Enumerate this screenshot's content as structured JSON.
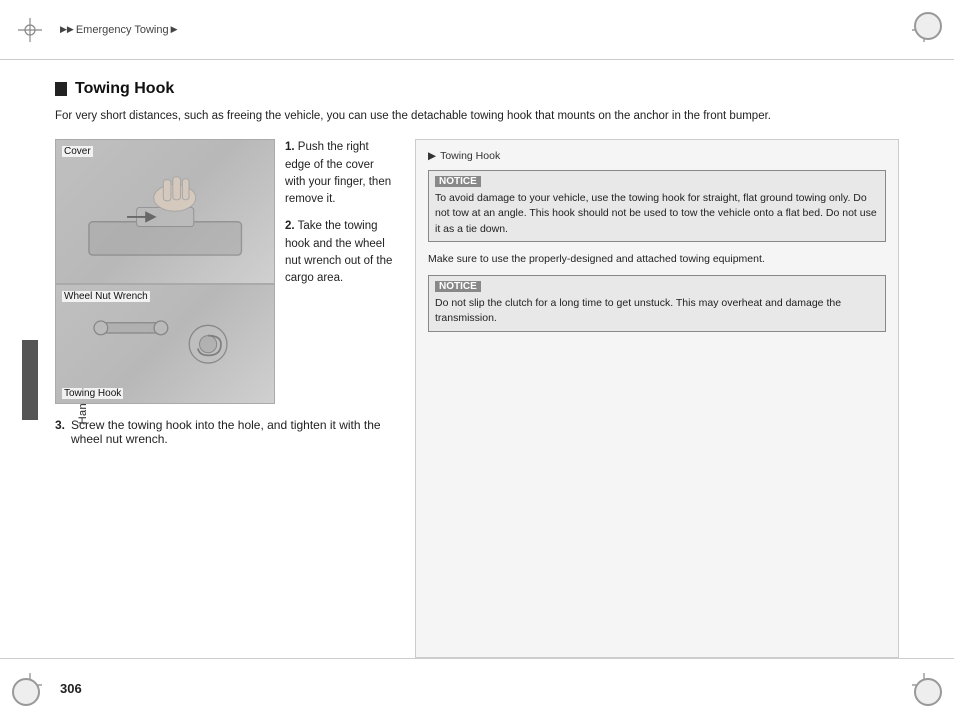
{
  "page": {
    "number": "306",
    "background": "#ffffff"
  },
  "breadcrumb": {
    "prefix_arrow": "▶▶",
    "section": "Emergency Towing",
    "suffix_arrow": "▶"
  },
  "sidebar": {
    "label": "Handling the Unexpected"
  },
  "right_col_title": {
    "arrow": "▶",
    "text": "Towing Hook"
  },
  "section": {
    "title": "Towing Hook",
    "intro": "For very short distances, such as freeing the vehicle, you can use the detachable towing hook that mounts on the anchor in the front bumper."
  },
  "images": {
    "top": {
      "label_cover": "Cover",
      "alt": "Hand pushing cover on front bumper"
    },
    "bottom": {
      "label_wheel": "Wheel Nut Wrench",
      "label_hook": "Towing Hook",
      "alt": "Towing hook and wheel nut wrench"
    }
  },
  "steps": {
    "step1_bold": "1.",
    "step1_text": "Push the right edge of the cover with your finger, then remove it.",
    "step2_bold": "2.",
    "step2_text": "Take the towing hook and the wheel nut wrench out of the cargo area.",
    "step3_bold": "3.",
    "step3_text": "Screw the towing hook into the hole, and tighten it with the wheel nut wrench."
  },
  "notices": {
    "notice1": {
      "label": "NOTICE",
      "text": "To avoid damage to your vehicle, use the towing hook for straight, flat ground towing only. Do not tow at an angle. This hook should not be used to tow the vehicle onto a flat bed. Do not use it as a tie down."
    },
    "separator": "Make sure to use the properly-designed and attached towing equipment.",
    "notice2": {
      "label": "NOTICE",
      "text": "Do not slip the clutch for a long time to get unstuck. This may overheat and damage the transmission."
    }
  }
}
